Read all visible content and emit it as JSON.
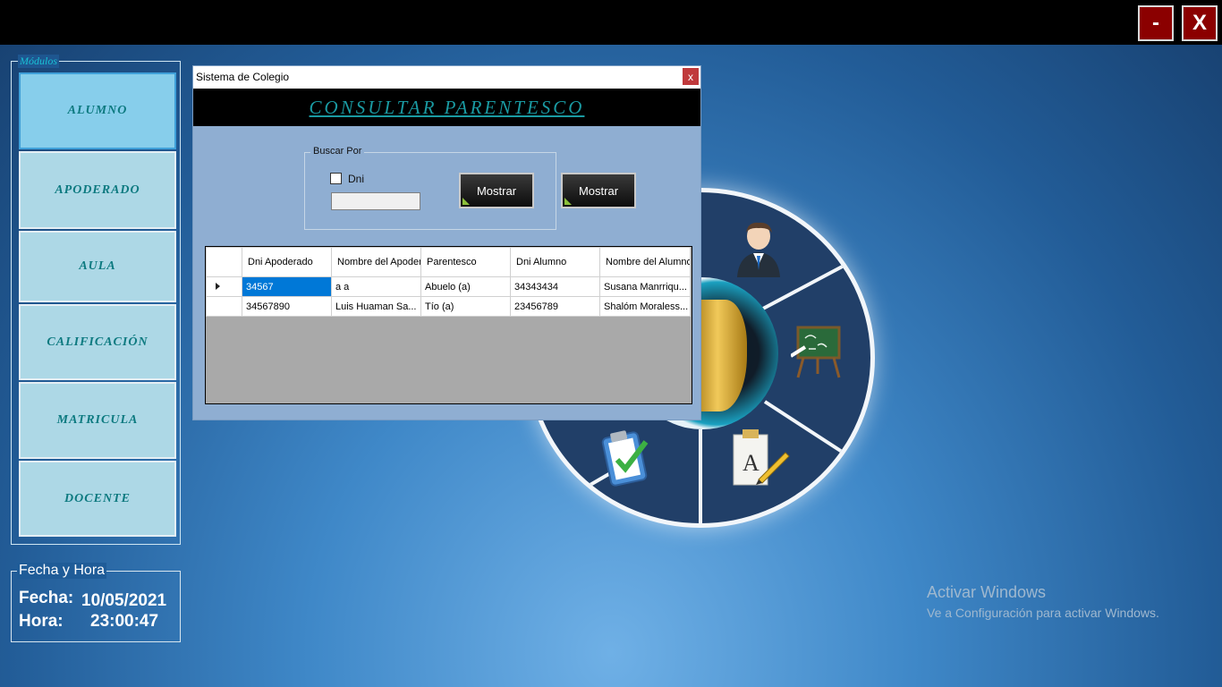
{
  "window_controls": {
    "minimize_label": "-",
    "close_label": "X"
  },
  "modules": {
    "legend": "Módulos",
    "items": [
      {
        "label": "ALUMNO"
      },
      {
        "label": "APODERADO"
      },
      {
        "label": "AULA"
      },
      {
        "label": "CALIFICACIÓN"
      },
      {
        "label": "MATRICULA"
      },
      {
        "label": "DOCENTE"
      }
    ]
  },
  "fecha_hora": {
    "legend": "Fecha y Hora",
    "fecha_label": "Fecha:",
    "fecha_value": "10/05/2021",
    "hora_label": "Hora:",
    "hora_value": "23:00:47"
  },
  "dialog": {
    "title": "Sistema de Colegio",
    "close_label": "x",
    "header": "CONSULTAR PARENTESCO",
    "buscar": {
      "legend": "Buscar Por",
      "checkbox_label": "Dni",
      "input_value": "",
      "button1_label": "Mostrar",
      "button2_label": "Mostrar"
    },
    "grid": {
      "columns": [
        "Dni Apoderado",
        "Nombre del Apoderado",
        "Parentesco",
        "Dni Alumno",
        "Nombre del Alumno"
      ],
      "rows": [
        [
          "34567",
          "a  a",
          "Abuelo (a)",
          "34343434",
          "Susana  Manrriqu..."
        ],
        [
          "34567890",
          "Luis  Huaman Sa...",
          "Tío (a)",
          "23456789",
          "Shalóm  Moraless..."
        ]
      ]
    }
  },
  "windows_activation": {
    "title": "Activar Windows",
    "subtitle": "Ve a Configuración para activar Windows."
  },
  "colors": {
    "topbar": "#000000",
    "window_button": "#8b0000",
    "module_button": "#add8e6",
    "module_text": "#0d7a80",
    "dialog_bg": "#8faed2",
    "header_text": "#1a9aa2",
    "selection": "#0078d7"
  }
}
